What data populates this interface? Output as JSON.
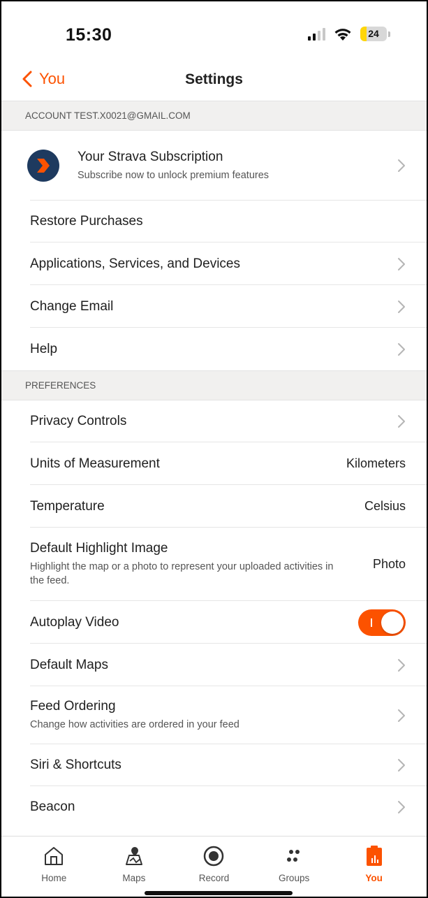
{
  "status_bar": {
    "time": "15:30",
    "battery": "24",
    "battery_fraction": 0.24
  },
  "nav": {
    "back_label": "You",
    "title": "Settings"
  },
  "colors": {
    "accent": "#fc5200",
    "section_bg": "#f1f0ef",
    "avatar_bg": "#1e3a5f"
  },
  "account": {
    "header": "ACCOUNT TEST.X0021@GMAIL.COM",
    "subscription": {
      "title": "Your Strava Subscription",
      "subtitle": "Subscribe now to unlock premium features",
      "icon": "strava-chevron-logo"
    },
    "restore": "Restore Purchases",
    "apps": "Applications, Services, and Devices",
    "change_email": "Change Email",
    "help": "Help"
  },
  "preferences": {
    "header": "PREFERENCES",
    "privacy": "Privacy Controls",
    "units": {
      "label": "Units of Measurement",
      "value": "Kilometers"
    },
    "temperature": {
      "label": "Temperature",
      "value": "Celsius"
    },
    "highlight": {
      "label": "Default Highlight Image",
      "subtitle": "Highlight the map or a photo to represent your uploaded activities in the feed.",
      "value": "Photo"
    },
    "autoplay": {
      "label": "Autoplay Video",
      "enabled": true
    },
    "default_maps": "Default Maps",
    "feed_ordering": {
      "label": "Feed Ordering",
      "subtitle": "Change how activities are ordered in your feed"
    },
    "siri": "Siri & Shortcuts",
    "beacon": "Beacon"
  },
  "tabbar": {
    "home": {
      "label": "Home",
      "icon": "home-icon"
    },
    "maps": {
      "label": "Maps",
      "icon": "maps-icon"
    },
    "record": {
      "label": "Record",
      "icon": "record-icon"
    },
    "groups": {
      "label": "Groups",
      "icon": "groups-icon"
    },
    "you": {
      "label": "You",
      "icon": "you-icon",
      "active": true
    }
  }
}
